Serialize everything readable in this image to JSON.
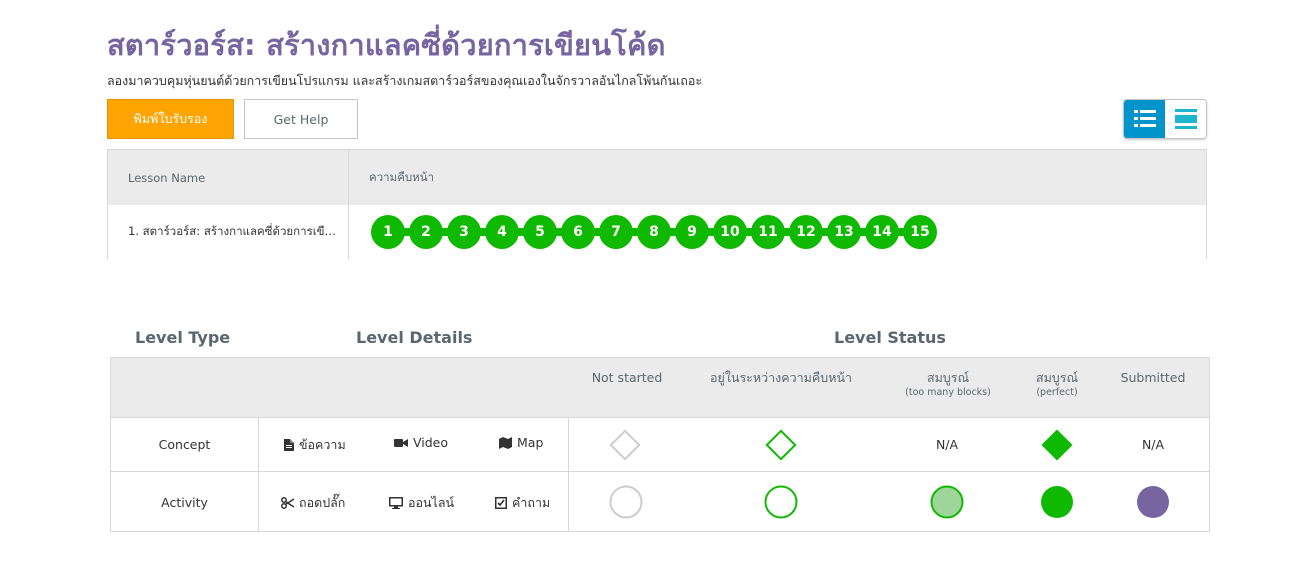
{
  "header": {
    "title": "สตาร์วอร์ส: สร้างกาแลคซี่ด้วยการเขียนโค้ด",
    "subtitle": "ลองมาควบคุมหุ่นยนต์ด้วยการเขียนโปรแกรม และสร้างเกมสตาร์วอร์สของคุณเองในจักรวาลอันไกลโพ้นกันเถอะ"
  },
  "actions": {
    "print_label": "พิมพ์ใบรับรอง",
    "help_label": "Get Help"
  },
  "view_toggle": {
    "active": "detail-view",
    "icons": [
      "list-detail-icon",
      "list-summary-icon"
    ],
    "accent": "#0094ca"
  },
  "progress": {
    "col_lesson": "Lesson Name",
    "col_progress": "ความคืบหน้า",
    "lessons": [
      {
        "name": "1. สตาร์วอร์ส: สร้างกาแลคซี่ด้วยการเขีย...",
        "levels": [
          "1",
          "2",
          "3",
          "4",
          "5",
          "6",
          "7",
          "8",
          "9",
          "10",
          "11",
          "12",
          "13",
          "14",
          "15"
        ]
      }
    ],
    "bubble_color": "#0eb900"
  },
  "key": {
    "header_type": "Level Type",
    "header_details": "Level Details",
    "header_status": "Level Status",
    "status_cols": {
      "not_started": "Not started",
      "in_progress": "อยู่ในระหว่างความคืบหน้า",
      "too_many": "สมบูรณ์",
      "too_many_sub": "(too many blocks)",
      "perfect": "สมบูรณ์",
      "perfect_sub": "(perfect)",
      "submitted": "Submitted"
    },
    "rows": {
      "concept": {
        "type": "Concept",
        "details": [
          "ข้อความ",
          "Video",
          "Map"
        ],
        "too_many": "N/A",
        "submitted": "N/A"
      },
      "activity": {
        "type": "Activity",
        "details": [
          "ถอดปลั๊ก",
          "ออนไลน์",
          "คำถาม"
        ]
      }
    },
    "colors": {
      "not_started": "#cccccc",
      "in_progress": "#0eb900",
      "too_many": "#9fd49a",
      "perfect": "#0eb900",
      "submitted": "#7665a0"
    }
  }
}
